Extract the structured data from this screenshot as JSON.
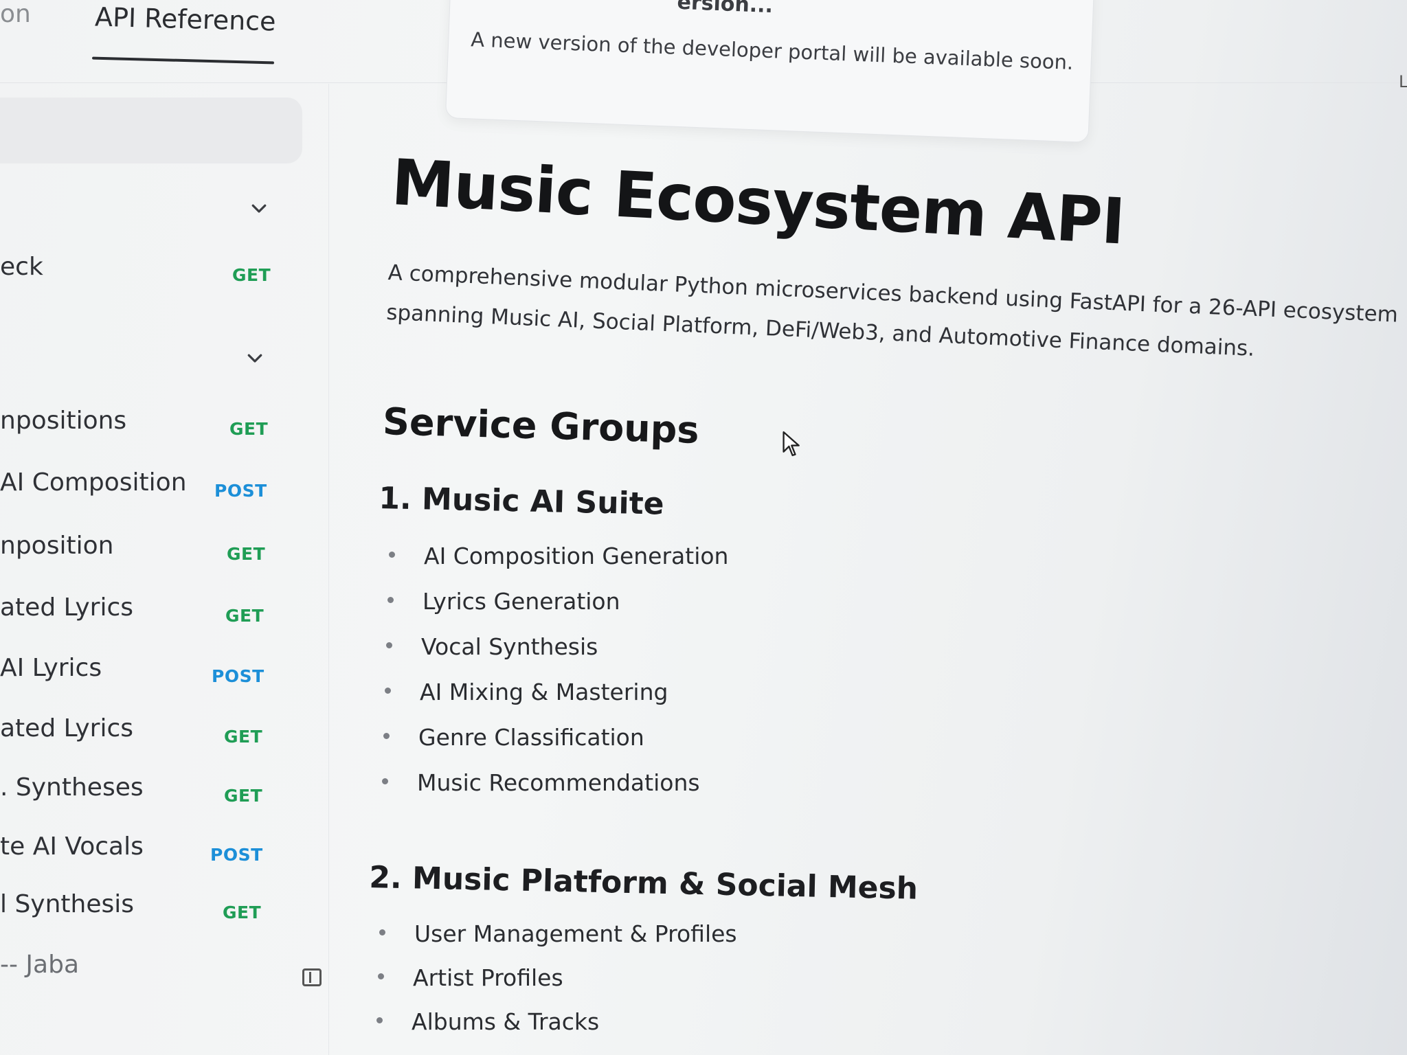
{
  "nav": {
    "partial_tab": "on",
    "active_tab": "API Reference"
  },
  "banner": {
    "title_fragment": "ersion...",
    "message": "A new version of the developer portal will be available soon.",
    "right_glyph": "L"
  },
  "sidebar": {
    "items": [
      {
        "label": "eck",
        "method": "GET"
      },
      {
        "label": "npositions",
        "method": "GET"
      },
      {
        "label": "AI Composition",
        "method": "POST"
      },
      {
        "label": "nposition",
        "method": "GET"
      },
      {
        "label": "ated Lyrics",
        "method": "GET"
      },
      {
        "label": "AI Lyrics",
        "method": "POST"
      },
      {
        "label": "ated Lyrics",
        "method": "GET"
      },
      {
        "label": ". Syntheses",
        "method": "GET"
      },
      {
        "label": "te AI Vocals",
        "method": "POST"
      },
      {
        "label": "l Synthesis",
        "method": "GET"
      },
      {
        "label": "-- Jaba",
        "method": ""
      }
    ]
  },
  "main": {
    "title": "Music Ecosystem API",
    "description": "A comprehensive modular Python microservices backend using FastAPI for a 26-API ecosystem spanning Music AI, Social Platform, DeFi/Web3, and Automotive Finance domains.",
    "section_title": "Service Groups",
    "groups": [
      {
        "title": "1. Music AI Suite",
        "items": [
          "AI Composition Generation",
          "Lyrics Generation",
          "Vocal Synthesis",
          "AI Mixing & Mastering",
          "Genre Classification",
          "Music Recommendations"
        ]
      },
      {
        "title": "2. Music Platform & Social Mesh",
        "items": [
          "User Management & Profiles",
          "Artist Profiles",
          "Albums & Tracks"
        ]
      }
    ]
  },
  "colors": {
    "get": "#1f9d55",
    "post": "#1c8fd8"
  },
  "icons": {
    "chevron": "chevron-down-icon",
    "collapse": "sidebar-toggle-icon",
    "cursor": "mouse-pointer-icon"
  }
}
